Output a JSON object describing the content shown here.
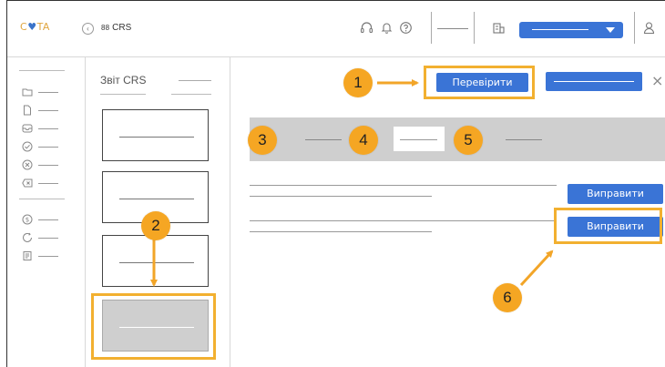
{
  "header": {
    "logo_pre": "C",
    "logo_heart": "♥",
    "logo_post": "TA",
    "collapse_icon": "‹",
    "app_icon": "8 8",
    "app_name": "CRS",
    "icons": [
      "headset-icon",
      "bell-icon",
      "help-icon",
      "building-icon",
      "user-icon"
    ]
  },
  "sidebar": {
    "icons": [
      "folder-icon",
      "document-icon",
      "inbox-icon",
      "check-circle-icon",
      "cancel-circle-icon",
      "delete-tag-icon",
      "dollar-circle-icon",
      "globe-refresh-icon",
      "report-icon"
    ]
  },
  "middle": {
    "title": "Звіт CRS"
  },
  "main": {
    "check_button": "Перевірити",
    "close_glyph": "×",
    "fix_button_1": "Виправити",
    "fix_button_2": "Виправити"
  },
  "annotations": {
    "b1": "1",
    "b2": "2",
    "b3": "3",
    "b4": "4",
    "b5": "5",
    "b6": "6"
  },
  "colors": {
    "accent_blue": "#3a74d6",
    "annotation_orange": "#f5a623",
    "panel_gray": "#cfcfcf"
  }
}
